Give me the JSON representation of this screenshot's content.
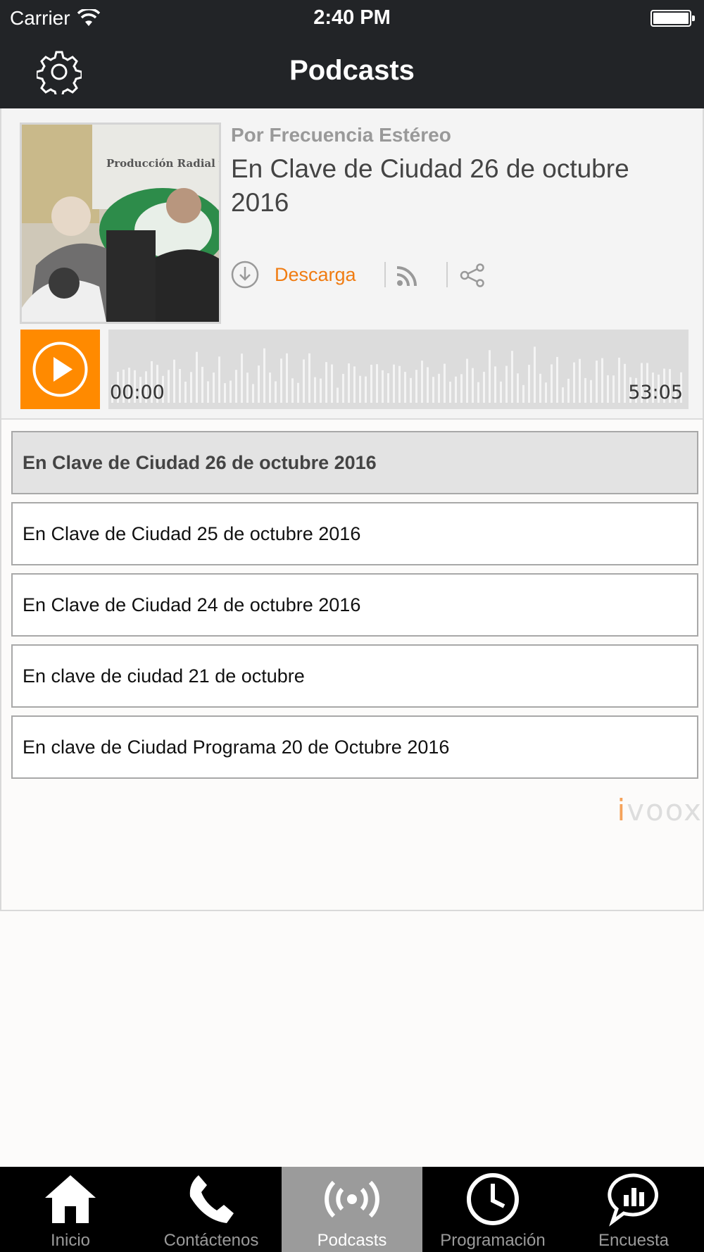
{
  "status_bar": {
    "carrier": "Carrier",
    "time": "2:40 PM"
  },
  "nav": {
    "title": "Podcasts"
  },
  "player": {
    "author": "Por Frecuencia Estéreo",
    "episode_title": "En Clave de Ciudad 26 de octubre 2016",
    "download_label": "Descarga",
    "current_time": "00:00",
    "total_time": "53:05",
    "progress": 0,
    "accent_color": "#ff8a00"
  },
  "episodes": [
    {
      "title": "En Clave de Ciudad 26 de octubre 2016",
      "selected": true
    },
    {
      "title": "En Clave de Ciudad 25 de octubre 2016",
      "selected": false
    },
    {
      "title": "En Clave de Ciudad 24 de octubre 2016",
      "selected": false
    },
    {
      "title": "En clave de ciudad 21 de octubre",
      "selected": false
    },
    {
      "title": "En clave de Ciudad Programa 20 de Octubre 2016",
      "selected": false
    }
  ],
  "branding": {
    "i": "i",
    "rest": "voox"
  },
  "tabs": [
    {
      "label": "Inicio",
      "icon": "home-icon",
      "active": false
    },
    {
      "label": "Contáctenos",
      "icon": "phone-icon",
      "active": false
    },
    {
      "label": "Podcasts",
      "icon": "broadcast-icon",
      "active": true
    },
    {
      "label": "Programación",
      "icon": "clock-icon",
      "active": false
    },
    {
      "label": "Encuesta",
      "icon": "chat-chart-icon",
      "active": false
    }
  ]
}
